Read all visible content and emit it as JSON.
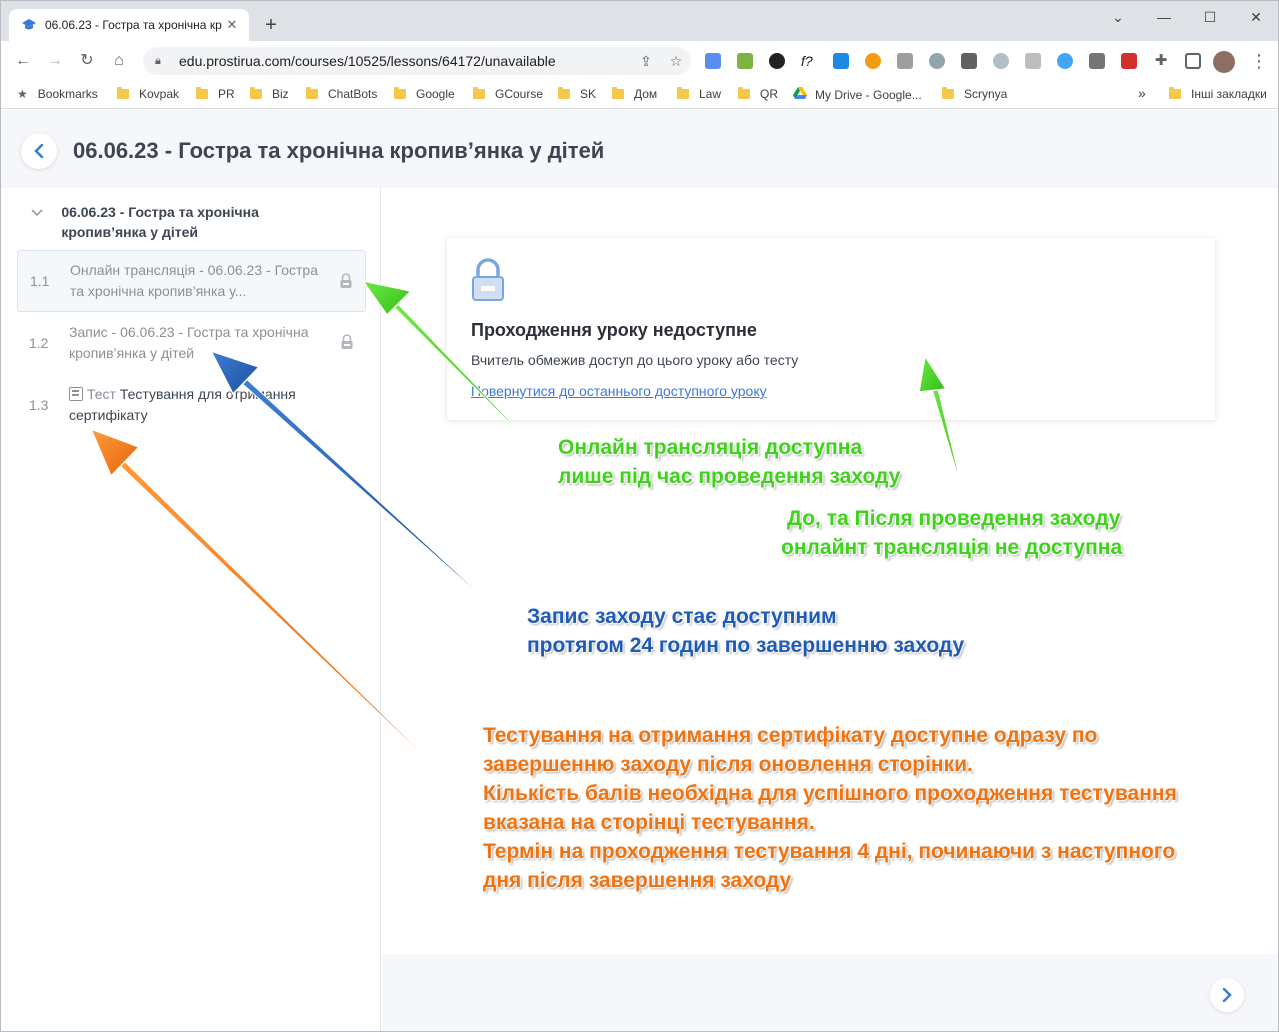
{
  "browser": {
    "tab_title": "06.06.23 - Гостра та хронічна кр",
    "url": "edu.prostirua.com/courses/10525/lessons/64172/unavailable",
    "window_controls": [
      "⌄",
      "—",
      "☐",
      "✕"
    ],
    "bookmarks": [
      "Bookmarks",
      "Kovpak",
      "PR",
      "Biz",
      "ChatBots",
      "Google",
      "GCourse",
      "SK",
      "Дом",
      "Law",
      "QR",
      "My Drive - Google...",
      "Scrynya"
    ],
    "bookmarks_more": "»",
    "other_bookmarks": "Інші закладки"
  },
  "page": {
    "title": "06.06.23 - Гостра та хронічна кропив’янка у дітей",
    "sidebar": {
      "module_title": "06.06.23 - Гостра та хронічна кропив’янка у дітей",
      "lessons": [
        {
          "num": "1.1",
          "text": "Онлайн трансляція - 06.06.23 - Гостра та хронічна кропив’янка у...",
          "locked": true
        },
        {
          "num": "1.2",
          "text": "Запис - 06.06.23 - Гостра та хронічна кропив’янка у дітей",
          "locked": true
        },
        {
          "num": "1.3",
          "prefix": "Тест",
          "text": "Тестування для отримання сертифікату",
          "locked": false
        }
      ]
    },
    "card": {
      "title": "Проходження уроку недоступне",
      "text": "Вчитель обмежив доступ до цього уроку або тесту",
      "link": "Повернутися до останнього доступного уроку"
    }
  },
  "annotations": {
    "green1": [
      "Онлайн трансляція доступна",
      "лише під час проведення заходу"
    ],
    "green2": [
      "До, та Після проведення заходу",
      "онлайнт трансляція не доступна"
    ],
    "blue": [
      "Запис заходу стає доступним",
      "протягом 24 годин по завершенню заходу"
    ],
    "orange": [
      "Тестування на отримання сертифікату доступне одразу по",
      "завершенню заходу після оновлення сторінки.",
      "Кількість балів необхідна для успішного проходження тестування",
      "вказана на сторінці тестування.",
      "Термін на проходження тестування 4 дні, починаючи з наступного",
      "дня після завершення заходу"
    ]
  },
  "colors": {
    "accent": "#3a7bd5",
    "green_annotation": "#3ed31a",
    "blue_annotation": "#1f5bb5",
    "orange_annotation": "#f07312"
  }
}
